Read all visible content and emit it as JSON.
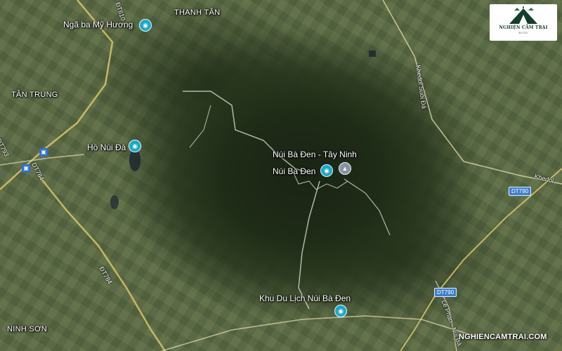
{
  "places": {
    "nga_ba_my_huong": "Ngã ba Mỹ Hương",
    "thanh_tan": "THANH TÂN",
    "tan_trung": "TÂN TRUNG",
    "ho_nui_da": "Hồ Núi Đá",
    "nui_ba_den_tay_ninh": "Núi Bà Đen - Tây Ninh",
    "nui_ba_den": "Núi Bà Đen",
    "khu_du_lich": "Khu Du Lịch Núi Bà Đen",
    "ninh_son": "NINH SƠN"
  },
  "roads": {
    "dt790_a": "DT790",
    "dt790_b": "DT790",
    "dt784": "DT784",
    "dt793": "DT793",
    "dt784_road": "ĐT784",
    "khedol_suoi_da": "Khedol Suối Đá",
    "khedol": "Khedol",
    "ql": "ĐT610",
    "le_phan": "Lê Phan - Núi Bà"
  },
  "icons": {
    "poi_color": "#1aa9c9",
    "shield_color": "#3d7fd0",
    "photo": "camera-icon",
    "bus": "bus-icon",
    "temple": "pagoda-icon"
  },
  "logo": {
    "name": "NGHIỆN CẮM TRẠI",
    "sub": "BLOG",
    "brand_color": "#143d2a"
  },
  "watermark": "NGHIENCAMTRAI.COM"
}
